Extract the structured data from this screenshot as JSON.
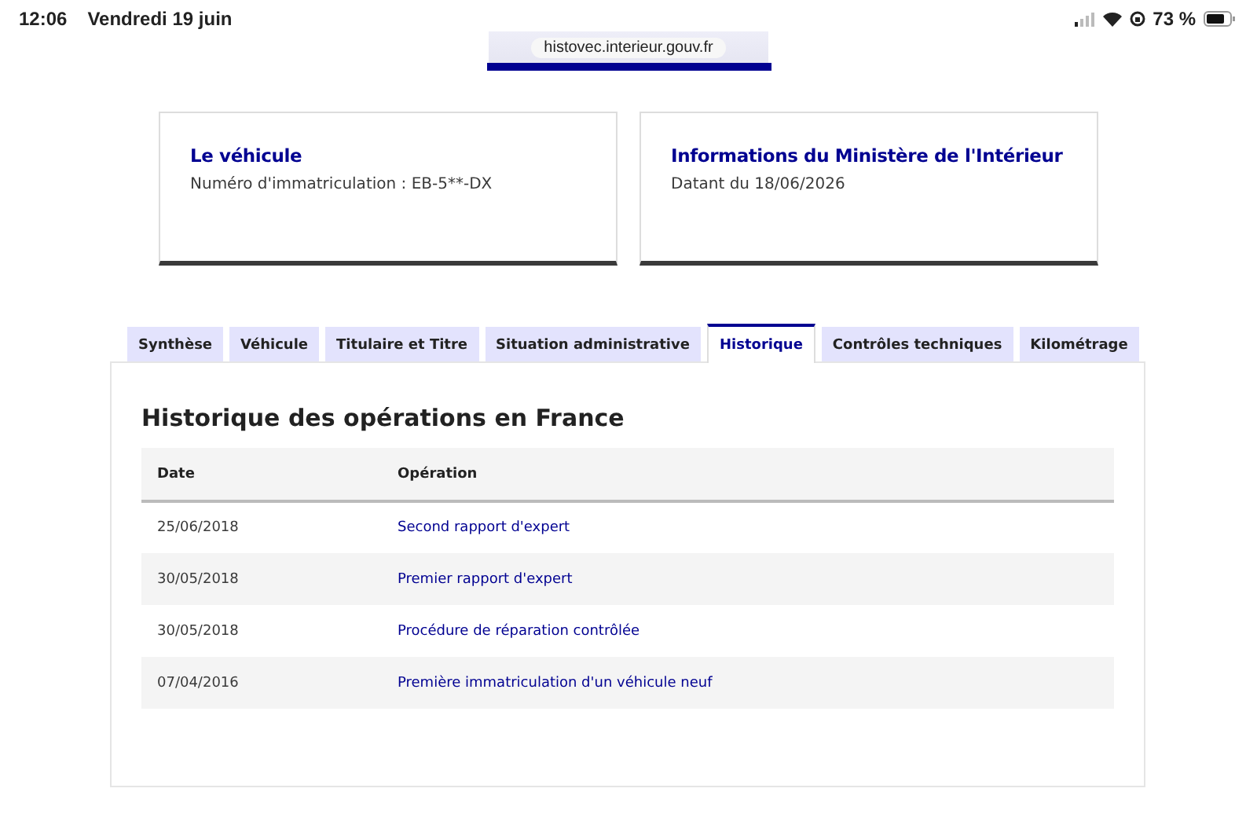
{
  "status_bar": {
    "time": "12:06",
    "date": "Vendredi 19 juin",
    "battery": "73 %"
  },
  "address_bar": {
    "url": "histovec.interieur.gouv.fr"
  },
  "cards": [
    {
      "title": "Le véhicule",
      "text": "Numéro d'immatriculation : EB-5**-DX"
    },
    {
      "title": "Informations du Ministère de l'Intérieur",
      "text": "Datant du 18/06/2026"
    }
  ],
  "tabs": [
    {
      "label": "Synthèse",
      "selected": false
    },
    {
      "label": "Véhicule",
      "selected": false
    },
    {
      "label": "Titulaire et Titre",
      "selected": false
    },
    {
      "label": "Situation administrative",
      "selected": false
    },
    {
      "label": "Historique",
      "selected": true
    },
    {
      "label": "Contrôles techniques",
      "selected": false
    },
    {
      "label": "Kilométrage",
      "selected": false
    }
  ],
  "section": {
    "title": "Historique des opérations en France",
    "table": {
      "columns": [
        "Date",
        "Opération"
      ],
      "rows": [
        {
          "date": "25/06/2018",
          "operation": "Second rapport d'expert"
        },
        {
          "date": "30/05/2018",
          "operation": "Premier rapport d'expert"
        },
        {
          "date": "30/05/2018",
          "operation": "Procédure de réparation contrôlée"
        },
        {
          "date": "07/04/2016",
          "operation": "Première immatriculation d'un véhicule neuf"
        }
      ]
    }
  }
}
